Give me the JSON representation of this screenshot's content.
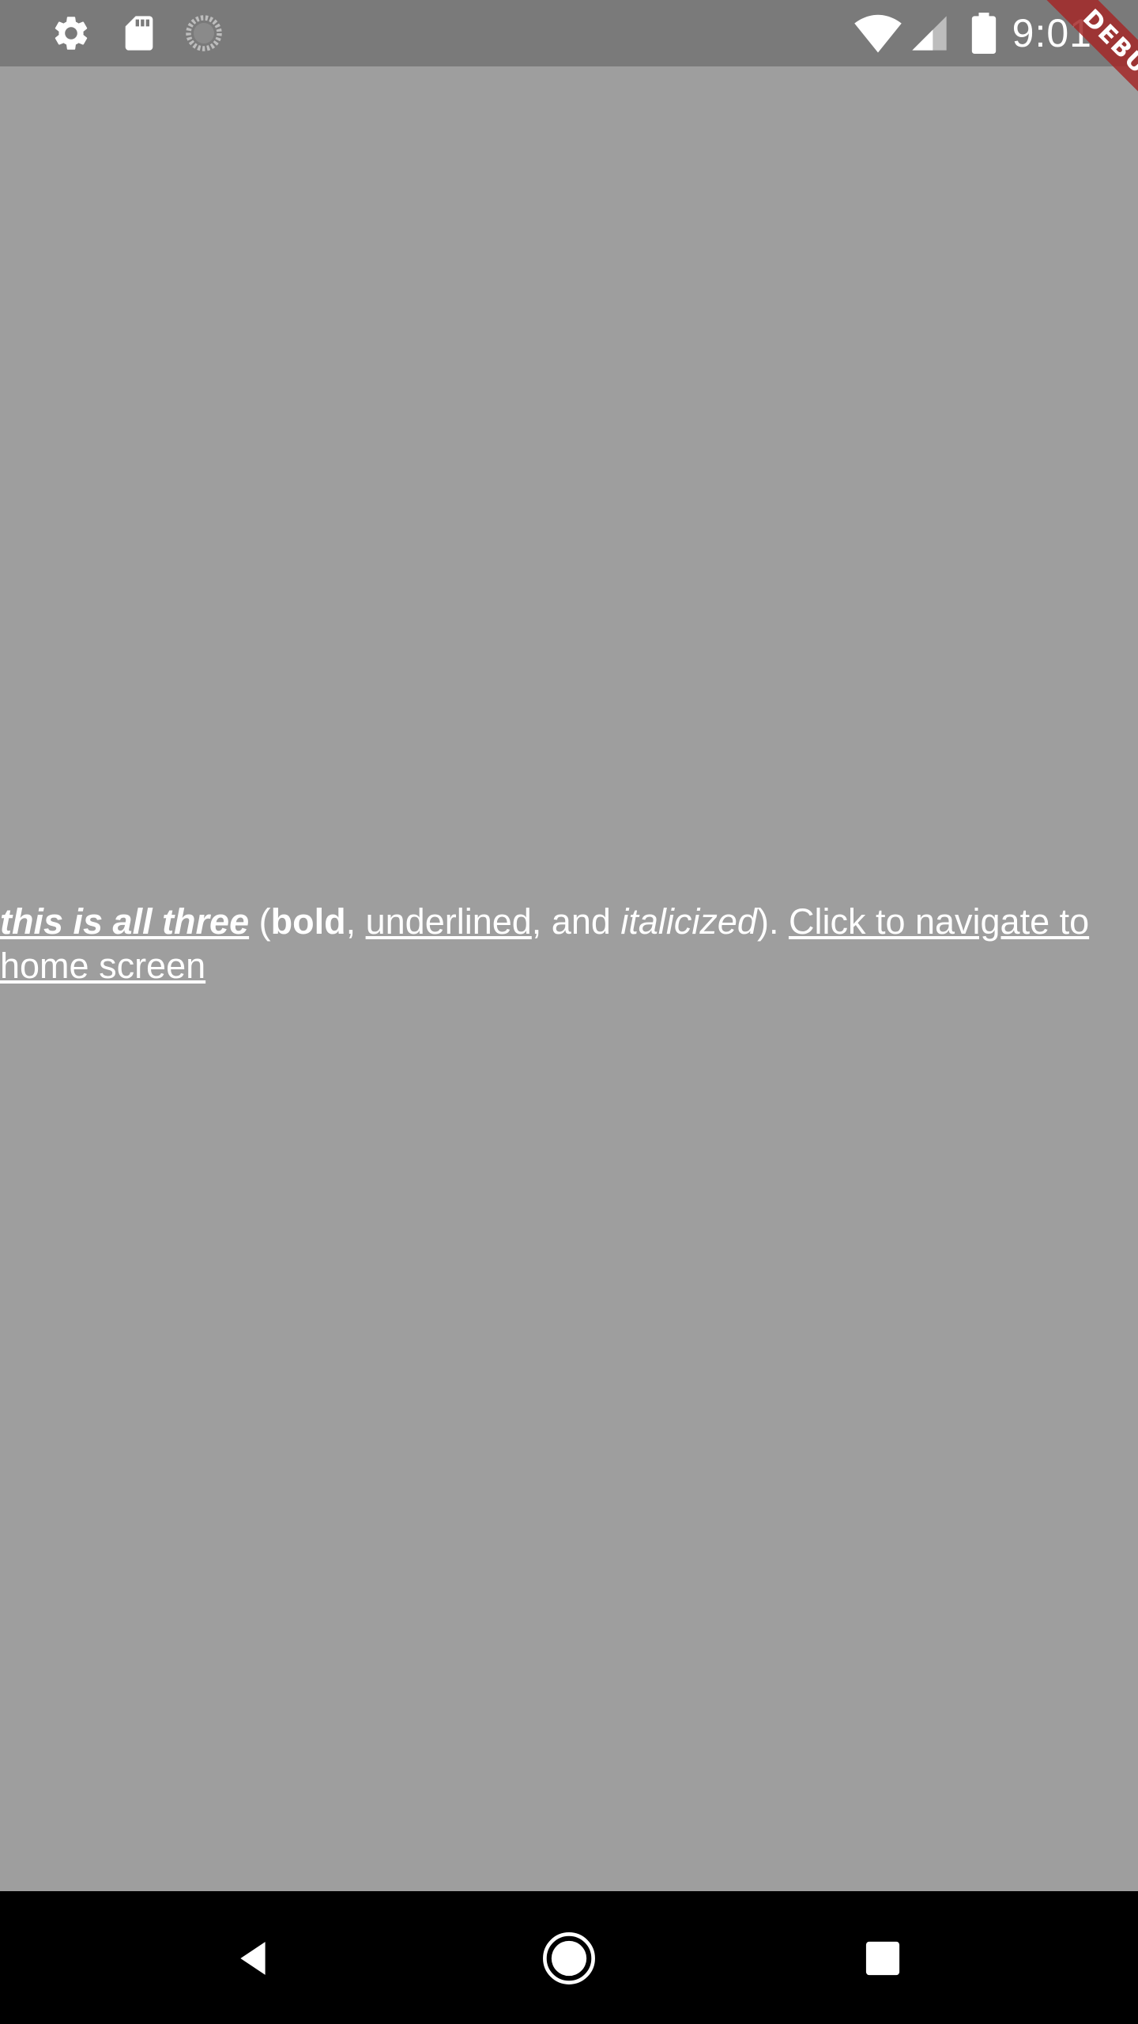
{
  "status_bar": {
    "time": "9:01",
    "icons_left": [
      "settings-icon",
      "sd-card-icon",
      "loading-spinner-icon"
    ],
    "icons_right": [
      "wifi-icon",
      "cellular-signal-icon",
      "battery-icon"
    ],
    "background_color": "#7a7a7a"
  },
  "debug_banner": {
    "label": "DEBUG",
    "color": "#a32828"
  },
  "content": {
    "all_three": "this is all three",
    "open_paren": " (",
    "bold": "bold",
    "comma1": ", ",
    "underlined": "underlined",
    "and_text": ", and ",
    "italicized": "italicized",
    "close_paren": "). ",
    "link": "Click to navigate to home screen",
    "text_color": "#ffffff",
    "background_color": "#9e9e9e"
  },
  "nav_bar": {
    "buttons": [
      "back-icon",
      "home-icon",
      "recents-icon"
    ],
    "background_color": "#000000"
  }
}
